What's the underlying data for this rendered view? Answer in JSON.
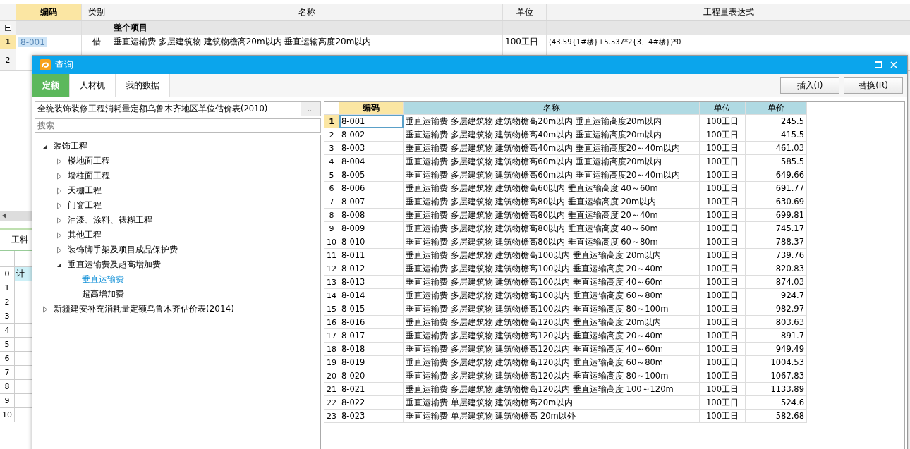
{
  "main_table": {
    "columns": [
      "编码",
      "类别",
      "名称",
      "单位",
      "工程量表达式"
    ],
    "rows": [
      {
        "kind": "group",
        "label": "整个项目",
        "expanded": true
      },
      {
        "kind": "item",
        "row_number": "1",
        "code": "8-001",
        "type": "借",
        "name": "垂直运输费 多层建筑物 建筑物檐高20m以内 垂直运输高度20m以内",
        "unit": "100工日",
        "expression": "(43.59{1#楼}+5.537*2{3、4#楼})*0",
        "selected": true
      },
      {
        "kind": "item",
        "row_number": "2",
        "selected": false
      }
    ]
  },
  "lower_panel": {
    "tab": "工料",
    "rows": [
      {
        "row_number": "0",
        "cell": "计"
      },
      {
        "row_number": "1"
      },
      {
        "row_number": "2"
      },
      {
        "row_number": "3"
      },
      {
        "row_number": "4"
      },
      {
        "row_number": "5"
      },
      {
        "row_number": "6"
      },
      {
        "row_number": "7"
      },
      {
        "row_number": "8"
      },
      {
        "row_number": "9"
      },
      {
        "row_number": "10"
      }
    ]
  },
  "dialog": {
    "title": "查询",
    "tabs": [
      {
        "label": "定额",
        "selected": true
      },
      {
        "label": "人材机",
        "selected": false
      },
      {
        "label": "我的数据",
        "selected": false
      }
    ],
    "buttons": [
      "插入(I)",
      "替换(R)"
    ],
    "library": "全统装饰装修工程消耗量定额乌鲁木齐地区单位估价表(2010)",
    "library_button": "...",
    "search": {
      "placeholder": "搜索"
    },
    "tree": [
      {
        "label": "装饰工程",
        "expanded": true,
        "selected": false,
        "children": [
          {
            "label": "楼地面工程",
            "expanded": false,
            "selected": false
          },
          {
            "label": "墙柱面工程",
            "expanded": false,
            "selected": false
          },
          {
            "label": "天棚工程",
            "expanded": false,
            "selected": false
          },
          {
            "label": "门窗工程",
            "expanded": false,
            "selected": false
          },
          {
            "label": "油漆、涂料、裱糊工程",
            "expanded": false,
            "selected": false
          },
          {
            "label": "其他工程",
            "expanded": false,
            "selected": false
          },
          {
            "label": "装饰脚手架及项目成品保护费",
            "expanded": false,
            "selected": false
          },
          {
            "label": "垂直运输费及超高增加费",
            "expanded": true,
            "selected": false,
            "children": [
              {
                "label": "垂直运输费",
                "selected": true
              },
              {
                "label": "超高增加费",
                "selected": false
              }
            ]
          }
        ]
      },
      {
        "label": "新疆建安补充消耗量定额乌鲁木齐估价表(2014)",
        "expanded": false,
        "selected": false
      }
    ],
    "table": {
      "columns": [
        "编码",
        "名称",
        "单位",
        "单价"
      ],
      "rows": [
        {
          "n": "1",
          "code": "8-001",
          "name": "垂直运输费 多层建筑物 建筑物檐高20m以内 垂直运输高度20m以内",
          "unit": "100工日",
          "price": "245.5",
          "selected": true
        },
        {
          "n": "2",
          "code": "8-002",
          "name": "垂直运输费 多层建筑物 建筑物檐高40m以内 垂直运输高度20m以内",
          "unit": "100工日",
          "price": "415.5",
          "selected": false
        },
        {
          "n": "3",
          "code": "8-003",
          "name": "垂直运输费 多层建筑物 建筑物檐高40m以内 垂直运输高度20～40m以内",
          "unit": "100工日",
          "price": "461.03",
          "selected": false
        },
        {
          "n": "4",
          "code": "8-004",
          "name": "垂直运输费 多层建筑物 建筑物檐高60m以内 垂直运输高度20m以内",
          "unit": "100工日",
          "price": "585.5",
          "selected": false
        },
        {
          "n": "5",
          "code": "8-005",
          "name": "垂直运输费 多层建筑物 建筑物檐高60m以内 垂直运输高度20～40m以内",
          "unit": "100工日",
          "price": "649.66",
          "selected": false
        },
        {
          "n": "6",
          "code": "8-006",
          "name": "垂直运输费 多层建筑物 建筑物檐高60以内 垂直运输高度 40～60m",
          "unit": "100工日",
          "price": "691.77",
          "selected": false
        },
        {
          "n": "7",
          "code": "8-007",
          "name": "垂直运输费 多层建筑物 建筑物檐高80以内 垂直运输高度 20m以内",
          "unit": "100工日",
          "price": "630.69",
          "selected": false
        },
        {
          "n": "8",
          "code": "8-008",
          "name": "垂直运输费 多层建筑物 建筑物檐高80以内 垂直运输高度 20～40m",
          "unit": "100工日",
          "price": "699.81",
          "selected": false
        },
        {
          "n": "9",
          "code": "8-009",
          "name": "垂直运输费 多层建筑物 建筑物檐高80以内 垂直运输高度 40～60m",
          "unit": "100工日",
          "price": "745.17",
          "selected": false
        },
        {
          "n": "10",
          "code": "8-010",
          "name": "垂直运输费 多层建筑物 建筑物檐高80以内 垂直运输高度 60～80m",
          "unit": "100工日",
          "price": "788.37",
          "selected": false
        },
        {
          "n": "11",
          "code": "8-011",
          "name": "垂直运输费 多层建筑物 建筑物檐高100以内 垂直运输高度 20m以内",
          "unit": "100工日",
          "price": "739.76",
          "selected": false
        },
        {
          "n": "12",
          "code": "8-012",
          "name": "垂直运输费 多层建筑物 建筑物檐高100以内 垂直运输高度 20～40m",
          "unit": "100工日",
          "price": "820.83",
          "selected": false
        },
        {
          "n": "13",
          "code": "8-013",
          "name": "垂直运输费 多层建筑物 建筑物檐高100以内 垂直运输高度 40～60m",
          "unit": "100工日",
          "price": "874.03",
          "selected": false
        },
        {
          "n": "14",
          "code": "8-014",
          "name": "垂直运输费 多层建筑物 建筑物檐高100以内 垂直运输高度 60～80m",
          "unit": "100工日",
          "price": "924.7",
          "selected": false
        },
        {
          "n": "15",
          "code": "8-015",
          "name": "垂直运输费 多层建筑物 建筑物檐高100以内 垂直运输高度 80～100m",
          "unit": "100工日",
          "price": "982.97",
          "selected": false
        },
        {
          "n": "16",
          "code": "8-016",
          "name": "垂直运输费 多层建筑物 建筑物檐高120以内 垂直运输高度 20m以内",
          "unit": "100工日",
          "price": "803.63",
          "selected": false
        },
        {
          "n": "17",
          "code": "8-017",
          "name": "垂直运输费 多层建筑物 建筑物檐高120以内 垂直运输高度 20～40m",
          "unit": "100工日",
          "price": "891.7",
          "selected": false
        },
        {
          "n": "18",
          "code": "8-018",
          "name": "垂直运输费 多层建筑物 建筑物檐高120以内 垂直运输高度 40～60m",
          "unit": "100工日",
          "price": "949.49",
          "selected": false
        },
        {
          "n": "19",
          "code": "8-019",
          "name": "垂直运输费 多层建筑物 建筑物檐高120以内 垂直运输高度 60～80m",
          "unit": "100工日",
          "price": "1004.53",
          "selected": false
        },
        {
          "n": "20",
          "code": "8-020",
          "name": "垂直运输费 多层建筑物 建筑物檐高120以内 垂直运输高度 80～100m",
          "unit": "100工日",
          "price": "1067.83",
          "selected": false
        },
        {
          "n": "21",
          "code": "8-021",
          "name": "垂直运输费 多层建筑物 建筑物檐高120以内 垂直运输高度 100～120m",
          "unit": "100工日",
          "price": "1133.89",
          "selected": false
        },
        {
          "n": "22",
          "code": "8-022",
          "name": "垂直运输费 单层建筑物 建筑物檐高20m以内",
          "unit": "100工日",
          "price": "524.6",
          "selected": false
        },
        {
          "n": "23",
          "code": "8-023",
          "name": "垂直运输费 单层建筑物 建筑物檐高 20m以外",
          "unit": "100工日",
          "price": "582.68",
          "selected": false
        }
      ]
    }
  }
}
